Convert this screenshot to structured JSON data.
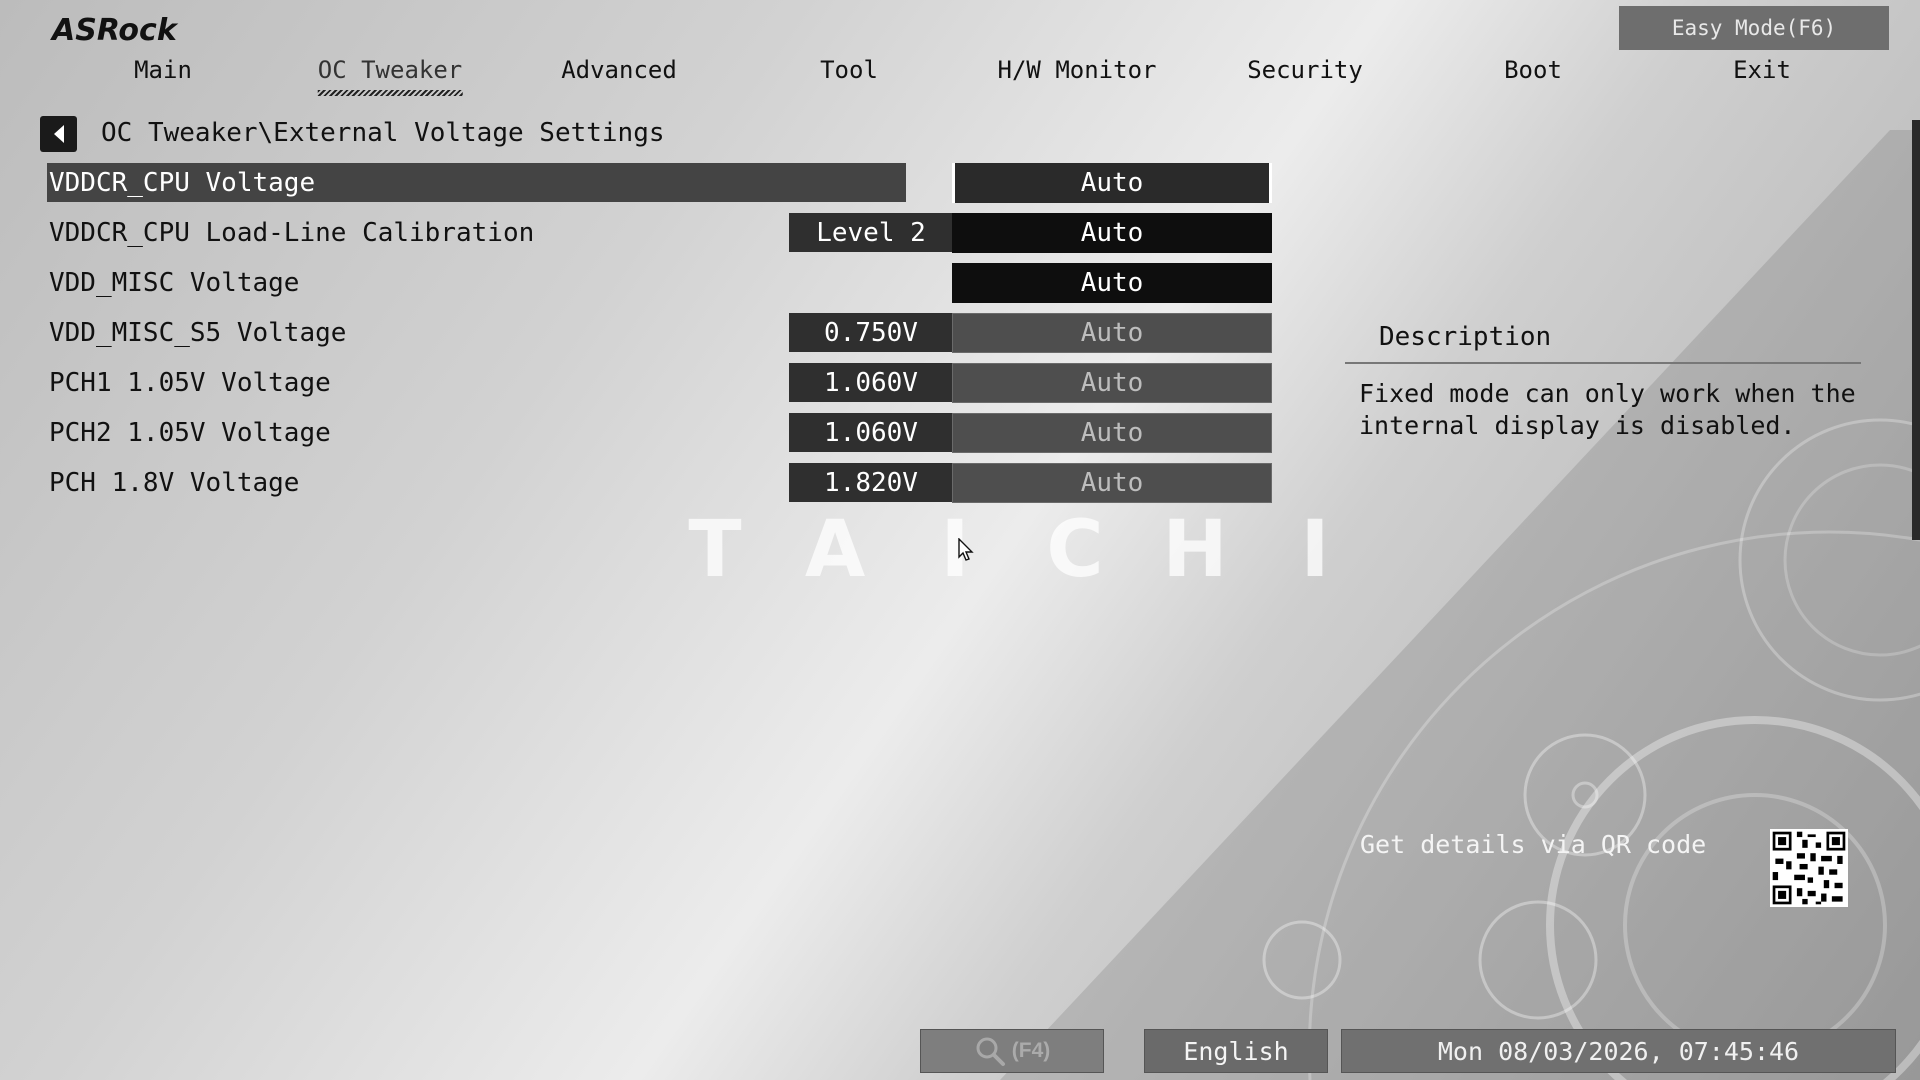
{
  "brand": {
    "logo_text": "ASRock",
    "watermark": [
      "T",
      "A",
      "I",
      "C",
      "H",
      "I"
    ]
  },
  "easy_mode_label": "Easy Mode(F6)",
  "tabs": [
    {
      "label": "Main"
    },
    {
      "label": "OC Tweaker",
      "active": true
    },
    {
      "label": "Advanced"
    },
    {
      "label": "Tool"
    },
    {
      "label": "H/W Monitor"
    },
    {
      "label": "Security"
    },
    {
      "label": "Boot"
    },
    {
      "label": "Exit"
    }
  ],
  "breadcrumb": "OC Tweaker\\External Voltage Settings",
  "settings": [
    {
      "label": "VDDCR_CPU Voltage",
      "current": "",
      "option": "Auto",
      "state": "selected"
    },
    {
      "label": "VDDCR_CPU Load-Line Calibration",
      "current": "Level 2",
      "option": "Auto",
      "state": "normal"
    },
    {
      "label": "VDD_MISC Voltage",
      "current": "",
      "option": "Auto",
      "state": "normal"
    },
    {
      "label": "VDD_MISC_S5 Voltage",
      "current": "0.750V",
      "option": "Auto",
      "state": "disabled"
    },
    {
      "label": "PCH1 1.05V Voltage",
      "current": "1.060V",
      "option": "Auto",
      "state": "disabled"
    },
    {
      "label": "PCH2 1.05V Voltage",
      "current": "1.060V",
      "option": "Auto",
      "state": "disabled"
    },
    {
      "label": "PCH 1.8V Voltage",
      "current": "1.820V",
      "option": "Auto",
      "state": "disabled"
    }
  ],
  "description": {
    "title": "Description",
    "text": "Fixed mode can only work when the internal display is disabled."
  },
  "qr": {
    "text": "Get details via QR code"
  },
  "footer": {
    "search_key": "(F4)",
    "language": "English",
    "datetime": "Mon 08/03/2026, 07:45:46"
  },
  "icons": [
    "back-arrow-icon",
    "search-icon",
    "mouse-cursor-icon",
    "qr-code-icon"
  ]
}
